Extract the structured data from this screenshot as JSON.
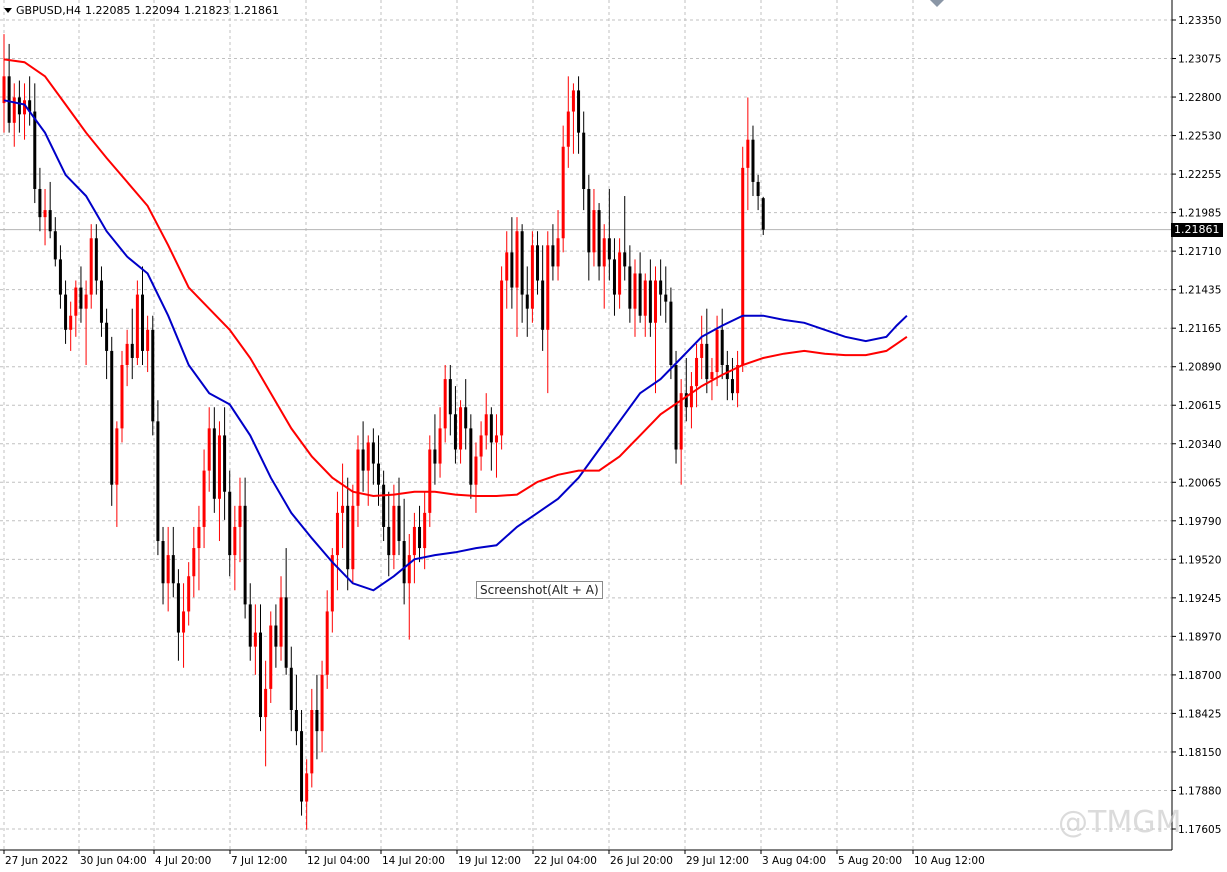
{
  "header": {
    "symbol": "GBPUSD,H4",
    "open": "1.22085",
    "high": "1.22094",
    "low": "1.21823",
    "close": "1.21861"
  },
  "tooltip": "Screenshot(Alt + A)",
  "watermark": "@TMGM",
  "current_price": "1.21861",
  "colors": {
    "bull": "#ff0000",
    "bear": "#000000",
    "ma_fast": "#0000c8",
    "ma_slow": "#ff0000",
    "grid": "#c0c0c0"
  },
  "chart_data": {
    "type": "candlestick",
    "ylim": [
      1.1759,
      1.2348
    ],
    "y_ticks": [
      "1.23350",
      "1.23075",
      "1.22800",
      "1.22530",
      "1.22255",
      "1.21985",
      "1.21710",
      "1.21435",
      "1.21165",
      "1.20890",
      "1.20615",
      "1.20340",
      "1.20065",
      "1.19790",
      "1.19520",
      "1.19245",
      "1.18970",
      "1.18700",
      "1.18425",
      "1.18150",
      "1.17880",
      "1.17605"
    ],
    "x_ticks": [
      "27 Jun 2022",
      "30 Jun 04:00",
      "4 Jul 20:00",
      "7 Jul 12:00",
      "12 Jul 04:00",
      "14 Jul 20:00",
      "19 Jul 12:00",
      "22 Jul 04:00",
      "26 Jul 20:00",
      "29 Jul 12:00",
      "3 Aug 04:00",
      "5 Aug 20:00",
      "10 Aug 12:00"
    ],
    "last_price": 1.21861,
    "candles": [
      [
        1.2276,
        1.2325,
        1.2255,
        1.2295
      ],
      [
        1.2295,
        1.2318,
        1.2255,
        1.2262
      ],
      [
        1.2262,
        1.229,
        1.2245,
        1.228
      ],
      [
        1.228,
        1.2292,
        1.2255,
        1.2268
      ],
      [
        1.2268,
        1.229,
        1.225,
        1.2278
      ],
      [
        1.2278,
        1.2295,
        1.226,
        1.227
      ],
      [
        1.227,
        1.229,
        1.2205,
        1.2215
      ],
      [
        1.2215,
        1.223,
        1.2185,
        1.2195
      ],
      [
        1.2195,
        1.2215,
        1.2175,
        1.22
      ],
      [
        1.22,
        1.222,
        1.218,
        1.2185
      ],
      [
        1.2185,
        1.2195,
        1.216,
        1.2165
      ],
      [
        1.2165,
        1.2175,
        1.213,
        1.214
      ],
      [
        1.214,
        1.215,
        1.2105,
        1.2115
      ],
      [
        1.2115,
        1.2135,
        1.21,
        1.2125
      ],
      [
        1.2125,
        1.215,
        1.211,
        1.2145
      ],
      [
        1.2145,
        1.216,
        1.212,
        1.213
      ],
      [
        1.213,
        1.215,
        1.209,
        1.214
      ],
      [
        1.214,
        1.219,
        1.213,
        1.218
      ],
      [
        1.218,
        1.219,
        1.214,
        1.215
      ],
      [
        1.215,
        1.216,
        1.211,
        1.212
      ],
      [
        1.212,
        1.213,
        1.208,
        1.21
      ],
      [
        1.21,
        1.211,
        1.199,
        1.2005
      ],
      [
        1.2005,
        1.205,
        1.1975,
        1.2045
      ],
      [
        1.2045,
        1.21,
        1.2035,
        1.209
      ],
      [
        1.209,
        1.2115,
        1.2075,
        1.2105
      ],
      [
        1.2105,
        1.213,
        1.208,
        1.2095
      ],
      [
        1.2095,
        1.215,
        1.209,
        1.214
      ],
      [
        1.214,
        1.216,
        1.209,
        1.21
      ],
      [
        1.21,
        1.2125,
        1.2085,
        1.2115
      ],
      [
        1.2115,
        1.2125,
        1.204,
        1.205
      ],
      [
        1.205,
        1.2065,
        1.1955,
        1.1965
      ],
      [
        1.1965,
        1.1975,
        1.192,
        1.1935
      ],
      [
        1.1935,
        1.1975,
        1.1915,
        1.1955
      ],
      [
        1.1955,
        1.1975,
        1.1925,
        1.1935
      ],
      [
        1.1935,
        1.1945,
        1.188,
        1.19
      ],
      [
        1.19,
        1.1935,
        1.1875,
        1.1915
      ],
      [
        1.1915,
        1.195,
        1.1905,
        1.194
      ],
      [
        1.194,
        1.1975,
        1.1925,
        1.196
      ],
      [
        1.196,
        1.199,
        1.193,
        1.1975
      ],
      [
        1.1975,
        1.203,
        1.196,
        1.2015
      ],
      [
        1.2015,
        1.206,
        1.2,
        1.2045
      ],
      [
        1.2045,
        1.206,
        1.1985,
        1.1995
      ],
      [
        1.1995,
        1.205,
        1.1965,
        1.204
      ],
      [
        1.204,
        1.206,
        1.198,
        1.2
      ],
      [
        1.2,
        1.2015,
        1.194,
        1.1955
      ],
      [
        1.1955,
        1.199,
        1.193,
        1.1975
      ],
      [
        1.1975,
        1.201,
        1.195,
        1.199
      ],
      [
        1.199,
        1.201,
        1.191,
        1.192
      ],
      [
        1.192,
        1.1935,
        1.188,
        1.189
      ],
      [
        1.189,
        1.192,
        1.187,
        1.19
      ],
      [
        1.19,
        1.192,
        1.183,
        1.184
      ],
      [
        1.184,
        1.188,
        1.1805,
        1.186
      ],
      [
        1.186,
        1.1915,
        1.185,
        1.1905
      ],
      [
        1.1905,
        1.192,
        1.1875,
        1.189
      ],
      [
        1.189,
        1.194,
        1.188,
        1.1925
      ],
      [
        1.1925,
        1.196,
        1.187,
        1.1875
      ],
      [
        1.1875,
        1.189,
        1.183,
        1.1845
      ],
      [
        1.1845,
        1.187,
        1.182,
        1.183
      ],
      [
        1.183,
        1.1845,
        1.177,
        1.178
      ],
      [
        1.178,
        1.181,
        1.176,
        1.18
      ],
      [
        1.18,
        1.186,
        1.179,
        1.1845
      ],
      [
        1.1845,
        1.187,
        1.181,
        1.183
      ],
      [
        1.183,
        1.188,
        1.1815,
        1.187
      ],
      [
        1.187,
        1.193,
        1.186,
        1.1915
      ],
      [
        1.1915,
        1.196,
        1.19,
        1.1955
      ],
      [
        1.1955,
        1.2,
        1.193,
        1.1985
      ],
      [
        1.1985,
        1.202,
        1.196,
        1.199
      ],
      [
        1.199,
        1.201,
        1.193,
        1.1945
      ],
      [
        1.1945,
        1.2005,
        1.1935,
        1.199
      ],
      [
        1.199,
        1.204,
        1.1975,
        1.203
      ],
      [
        1.203,
        1.205,
        1.2,
        1.2015
      ],
      [
        1.2015,
        1.204,
        1.199,
        1.2035
      ],
      [
        1.2035,
        1.2045,
        1.2005,
        1.202
      ],
      [
        1.202,
        1.204,
        1.199,
        1.2005
      ],
      [
        1.2005,
        1.2015,
        1.1965,
        1.1975
      ],
      [
        1.1975,
        1.2,
        1.194,
        1.1955
      ],
      [
        1.1955,
        1.2005,
        1.1945,
        1.199
      ],
      [
        1.199,
        1.201,
        1.1955,
        1.1965
      ],
      [
        1.1965,
        1.1995,
        1.192,
        1.1935
      ],
      [
        1.1935,
        1.197,
        1.1895,
        1.1955
      ],
      [
        1.1955,
        1.1985,
        1.1935,
        1.1975
      ],
      [
        1.1975,
        1.199,
        1.195,
        1.196
      ],
      [
        1.196,
        1.2,
        1.1945,
        1.1985
      ],
      [
        1.1985,
        1.204,
        1.1975,
        1.203
      ],
      [
        1.203,
        1.2055,
        1.2005,
        1.202
      ],
      [
        1.202,
        1.206,
        1.201,
        1.2045
      ],
      [
        1.2045,
        1.209,
        1.2035,
        1.208
      ],
      [
        1.208,
        1.209,
        1.204,
        1.2055
      ],
      [
        1.2055,
        1.2075,
        1.202,
        1.203
      ],
      [
        1.203,
        1.2065,
        1.202,
        1.206
      ],
      [
        1.206,
        1.208,
        1.203,
        1.2045
      ],
      [
        1.2045,
        1.2055,
        1.1995,
        1.2005
      ],
      [
        1.2005,
        1.2035,
        1.1985,
        1.2025
      ],
      [
        1.2025,
        1.205,
        1.2015,
        1.204
      ],
      [
        1.204,
        1.207,
        1.203,
        1.2055
      ],
      [
        1.2055,
        1.206,
        1.2015,
        1.2035
      ],
      [
        1.2035,
        1.2055,
        1.201,
        1.204
      ],
      [
        1.204,
        1.216,
        1.203,
        1.215
      ],
      [
        1.215,
        1.2185,
        1.213,
        1.217
      ],
      [
        1.217,
        1.2195,
        1.213,
        1.2145
      ],
      [
        1.2145,
        1.2195,
        1.211,
        1.2185
      ],
      [
        1.2185,
        1.219,
        1.212,
        1.214
      ],
      [
        1.214,
        1.216,
        1.211,
        1.213
      ],
      [
        1.213,
        1.2185,
        1.212,
        1.2175
      ],
      [
        1.2175,
        1.2185,
        1.214,
        1.215
      ],
      [
        1.215,
        1.2175,
        1.21,
        1.2115
      ],
      [
        1.2115,
        1.2185,
        1.207,
        1.2175
      ],
      [
        1.2175,
        1.219,
        1.215,
        1.216
      ],
      [
        1.216,
        1.22,
        1.215,
        1.218
      ],
      [
        1.218,
        1.226,
        1.217,
        1.2245
      ],
      [
        1.2245,
        1.2295,
        1.223,
        1.227
      ],
      [
        1.227,
        1.229,
        1.224,
        1.2285
      ],
      [
        1.2285,
        1.2295,
        1.224,
        1.2255
      ],
      [
        1.2255,
        1.227,
        1.22,
        1.2215
      ],
      [
        1.2215,
        1.2225,
        1.215,
        1.217
      ],
      [
        1.217,
        1.2215,
        1.216,
        1.22
      ],
      [
        1.22,
        1.2205,
        1.215,
        1.216
      ],
      [
        1.216,
        1.219,
        1.213,
        1.218
      ],
      [
        1.218,
        1.2215,
        1.215,
        1.2165
      ],
      [
        1.2165,
        1.218,
        1.2125,
        1.214
      ],
      [
        1.214,
        1.218,
        1.213,
        1.217
      ],
      [
        1.217,
        1.221,
        1.215,
        1.216
      ],
      [
        1.216,
        1.2175,
        1.212,
        1.213
      ],
      [
        1.213,
        1.2165,
        1.211,
        1.2155
      ],
      [
        1.2155,
        1.217,
        1.212,
        1.2125
      ],
      [
        1.2125,
        1.2155,
        1.211,
        1.215
      ],
      [
        1.215,
        1.2165,
        1.211,
        1.212
      ],
      [
        1.212,
        1.216,
        1.207,
        1.215
      ],
      [
        1.215,
        1.2165,
        1.2125,
        1.214
      ],
      [
        1.214,
        1.216,
        1.212,
        1.2135
      ],
      [
        1.2135,
        1.2145,
        1.208,
        1.209
      ],
      [
        1.209,
        1.21,
        1.202,
        1.203
      ],
      [
        1.203,
        1.208,
        1.2005,
        1.207
      ],
      [
        1.207,
        1.2095,
        1.205,
        1.206
      ],
      [
        1.206,
        1.2085,
        1.2045,
        1.2075
      ],
      [
        1.2075,
        1.2105,
        1.206,
        1.2095
      ],
      [
        1.2095,
        1.2125,
        1.208,
        1.2105
      ],
      [
        1.2105,
        1.213,
        1.207,
        1.208
      ],
      [
        1.208,
        1.2095,
        1.2065,
        1.2085
      ],
      [
        1.2085,
        1.2125,
        1.2075,
        1.2115
      ],
      [
        1.2115,
        1.213,
        1.208,
        1.209
      ],
      [
        1.209,
        1.21,
        1.2065,
        1.208
      ],
      [
        1.208,
        1.2095,
        1.2065,
        1.207
      ],
      [
        1.207,
        1.21,
        1.206,
        1.209
      ],
      [
        1.209,
        1.2245,
        1.2085,
        1.223
      ],
      [
        1.223,
        1.228,
        1.22,
        1.225
      ],
      [
        1.225,
        1.226,
        1.221,
        1.222
      ],
      [
        1.222,
        1.2225,
        1.22,
        1.221
      ],
      [
        1.22085,
        1.22094,
        1.21823,
        1.21861
      ]
    ],
    "series": [
      {
        "name": "",
        "color": "#0000c8",
        "values": [
          [
            0,
            1.2278
          ],
          [
            4,
            1.2275
          ],
          [
            8,
            1.2255
          ],
          [
            12,
            1.2225
          ],
          [
            16,
            1.221
          ],
          [
            20,
            1.2185
          ],
          [
            24,
            1.2167
          ],
          [
            28,
            1.2155
          ],
          [
            32,
            1.2125
          ],
          [
            36,
            1.209
          ],
          [
            40,
            1.207
          ],
          [
            44,
            1.2062
          ],
          [
            48,
            1.204
          ],
          [
            52,
            1.201
          ],
          [
            56,
            1.1985
          ],
          [
            60,
            1.1967
          ],
          [
            64,
            1.195
          ],
          [
            68,
            1.1935
          ],
          [
            72,
            1.193
          ],
          [
            76,
            1.194
          ],
          [
            80,
            1.1952
          ],
          [
            84,
            1.1955
          ],
          [
            88,
            1.1957
          ],
          [
            92,
            1.196
          ],
          [
            96,
            1.1962
          ],
          [
            100,
            1.1975
          ],
          [
            104,
            1.1985
          ],
          [
            108,
            1.1995
          ],
          [
            112,
            1.201
          ],
          [
            116,
            1.203
          ],
          [
            120,
            1.205
          ],
          [
            124,
            1.207
          ],
          [
            128,
            1.208
          ],
          [
            132,
            1.2095
          ],
          [
            136,
            1.211
          ],
          [
            140,
            1.2118
          ],
          [
            144,
            1.2125
          ],
          [
            148,
            1.2125
          ],
          [
            152,
            1.2122
          ],
          [
            156,
            1.212
          ],
          [
            160,
            1.2115
          ],
          [
            164,
            1.211
          ],
          [
            168,
            1.2107
          ],
          [
            172,
            1.211
          ],
          [
            174,
            1.2118
          ],
          [
            176,
            1.2125
          ]
        ]
      },
      {
        "name": "",
        "color": "#ff0000",
        "values": [
          [
            0,
            1.2307
          ],
          [
            4,
            1.2305
          ],
          [
            8,
            1.2295
          ],
          [
            12,
            1.2275
          ],
          [
            16,
            1.2255
          ],
          [
            20,
            1.2237
          ],
          [
            24,
            1.222
          ],
          [
            28,
            1.2203
          ],
          [
            32,
            1.2175
          ],
          [
            36,
            1.2145
          ],
          [
            40,
            1.213
          ],
          [
            44,
            1.2115
          ],
          [
            48,
            1.2095
          ],
          [
            52,
            1.207
          ],
          [
            56,
            1.2045
          ],
          [
            60,
            1.2025
          ],
          [
            64,
            1.201
          ],
          [
            68,
            1.2
          ],
          [
            72,
            1.1997
          ],
          [
            76,
            1.1998
          ],
          [
            80,
            1.2
          ],
          [
            84,
            1.2
          ],
          [
            88,
            1.1998
          ],
          [
            92,
            1.1997
          ],
          [
            96,
            1.1997
          ],
          [
            100,
            1.1998
          ],
          [
            104,
            1.2007
          ],
          [
            108,
            1.2012
          ],
          [
            112,
            1.2015
          ],
          [
            116,
            1.2015
          ],
          [
            120,
            1.2025
          ],
          [
            124,
            1.204
          ],
          [
            128,
            1.2055
          ],
          [
            132,
            1.2065
          ],
          [
            136,
            1.2075
          ],
          [
            140,
            1.2083
          ],
          [
            144,
            1.209
          ],
          [
            148,
            1.2095
          ],
          [
            152,
            1.2098
          ],
          [
            156,
            1.21
          ],
          [
            160,
            1.2098
          ],
          [
            164,
            1.2097
          ],
          [
            168,
            1.2097
          ],
          [
            172,
            1.21
          ],
          [
            174,
            1.2105
          ],
          [
            176,
            1.211
          ]
        ]
      }
    ],
    "grid": true
  }
}
